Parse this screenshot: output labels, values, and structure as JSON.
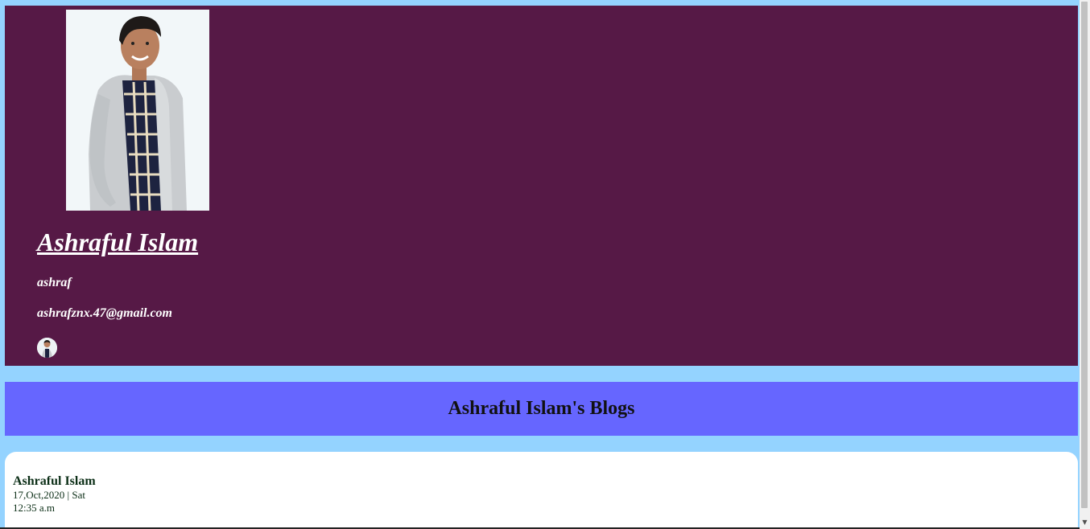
{
  "profile": {
    "name": "Ashraful Islam",
    "username": "ashraf",
    "email": "ashrafznx.47@gmail.com",
    "photo_icon": "profile-photo",
    "avatar_icon": "avatar-thumbnail"
  },
  "blogs": {
    "heading": "Ashraful Islam's Blogs"
  },
  "post": {
    "author": "Ashraful Islam",
    "date": "17,Oct,2020 | Sat",
    "time": "12:35 a.m"
  },
  "colors": {
    "page_background": "#94d3ff",
    "profile_background": "#561946",
    "banner_background": "#6666ff",
    "card_background": "#ffffff"
  }
}
